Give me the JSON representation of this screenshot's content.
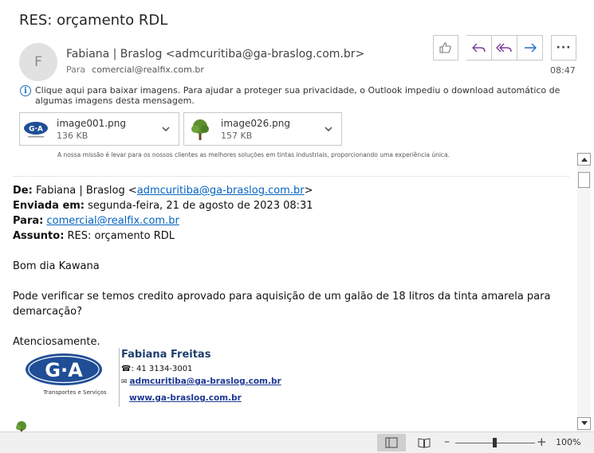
{
  "email": {
    "subject": "RES: orçamento RDL",
    "avatar_initial": "F",
    "sender": "Fabiana | Braslog <admcuritiba@ga-braslog.com.br>",
    "to_label": "Para",
    "to_value": "comercial@realfix.com.br",
    "time": "08:47",
    "info_text": "Clique aqui para baixar imagens. Para ajudar a proteger sua privacidade, o Outlook impediu o download automático de algumas imagens desta mensagem."
  },
  "actions": {
    "like_icon": "thumbs-up-icon",
    "reply_icon": "reply-icon",
    "reply_all_icon": "reply-all-icon",
    "forward_icon": "forward-icon",
    "more_label": "···"
  },
  "attachments": [
    {
      "name": "image001.png",
      "size": "136 KB"
    },
    {
      "name": "image026.png",
      "size": "157 KB"
    }
  ],
  "mission_text": "A nossa missão é levar para os nossos clientes as melhores soluções em tintas industriais, proporcionando uma experiência única.",
  "body": {
    "from_label": "De:",
    "from_name": " Fabiana | Braslog <",
    "from_email": "admcuritiba@ga-braslog.com.br",
    "from_close": ">",
    "sent_label": "Enviada em:",
    "sent_value": " segunda-feira, 21 de agosto de 2023 08:31",
    "to_label": "Para:",
    "to_email": "comercial@realfix.com.br",
    "subject_label": "Assunto:",
    "subject_value": " RES: orçamento RDL",
    "greeting": "Bom dia Kawana",
    "message": "Pode verificar se temos credito aprovado para aquisição de um galão de 18 litros da tinta amarela para demarcação?",
    "closing": "Atenciosamente."
  },
  "signature": {
    "logo_text": "G·A",
    "logo_sub": "Transportes e Serviços",
    "name": "Fabiana Freitas",
    "phone_icon": "☎:",
    "phone": " 41 3134-3001",
    "mail_icon": "✉",
    "email": "admcuritiba@ga-braslog.com.br",
    "website": "www.ga-braslog.com.br"
  },
  "status_bar": {
    "zoom_minus": "–",
    "zoom_plus": "+",
    "zoom_level": "100%",
    "zoom_fraction": 0.5
  },
  "colors": {
    "accent": "#1e6fc2",
    "link": "#0563c1",
    "brand_blue": "#1f4e96"
  }
}
